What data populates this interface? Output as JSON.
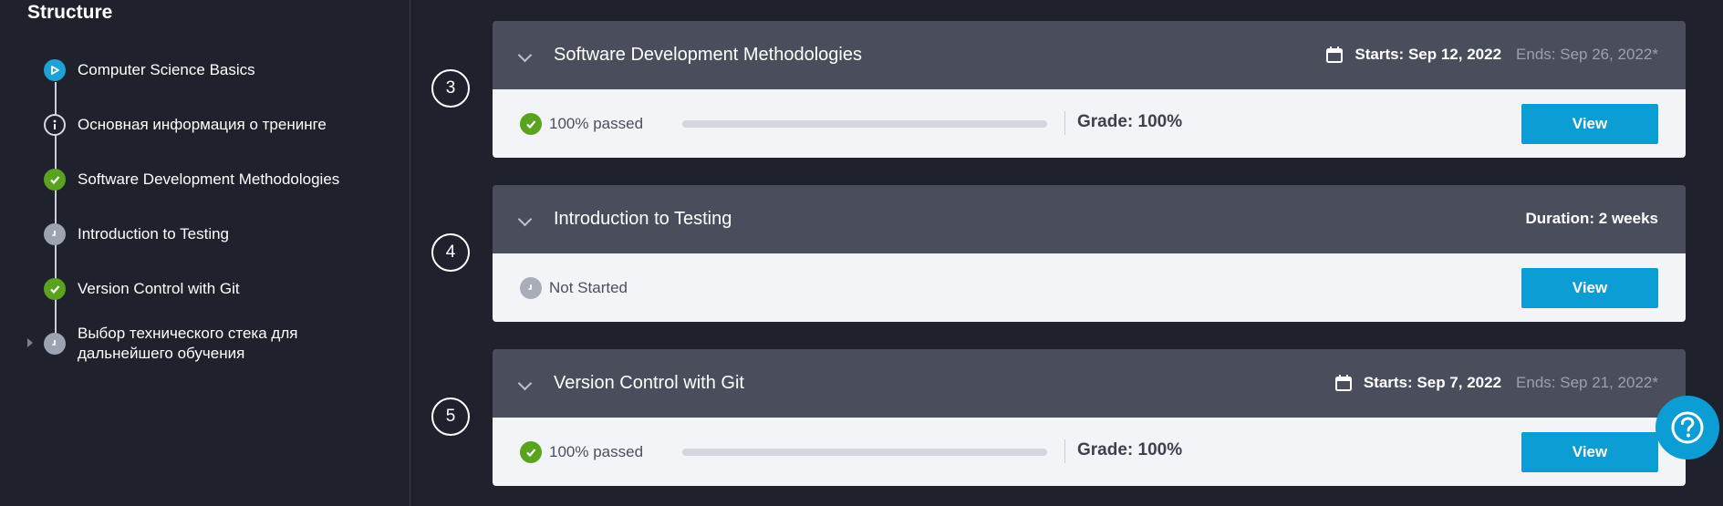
{
  "sidebar": {
    "title": "Structure",
    "items": [
      {
        "label": "Computer Science Basics",
        "status": "current",
        "icon": "play-icon"
      },
      {
        "label": "Основная информация о тренинге",
        "status": "info",
        "icon": "info-icon"
      },
      {
        "label": "Software Development Methodologies",
        "status": "passed",
        "icon": "check-icon"
      },
      {
        "label": "Introduction to Testing",
        "status": "not-started",
        "icon": "clock-icon"
      },
      {
        "label": "Version Control with Git",
        "status": "passed",
        "icon": "check-icon"
      },
      {
        "label": "Выбор технического стека для дальнейшего обучения",
        "status": "not-started",
        "icon": "clock-icon"
      }
    ]
  },
  "modules": [
    {
      "step": "3",
      "title": "Software Development Methodologies",
      "starts": "Starts: Sep 12, 2022",
      "ends": "Ends: Sep 26, 2022*",
      "status": "100% passed",
      "progress": 1.0,
      "grade": "Grade: 100%",
      "button": "View"
    },
    {
      "step": "4",
      "title": "Introduction to Testing",
      "duration": "Duration: 2 weeks",
      "status": "Not Started",
      "button": "View"
    },
    {
      "step": "5",
      "title": "Version Control with Git",
      "starts": "Starts: Sep 7, 2022",
      "ends": "Ends: Sep 21, 2022*",
      "status": "100% passed",
      "progress": 1.0,
      "grade": "Grade: 100%",
      "button": "View"
    }
  ],
  "colors": {
    "background": "#1f222c",
    "card_header": "#4a4d5c",
    "card_body": "#f3f4f7",
    "accent": "#0b9dd4",
    "passed": "#5aa31f",
    "pending": "#9ea3b1"
  }
}
